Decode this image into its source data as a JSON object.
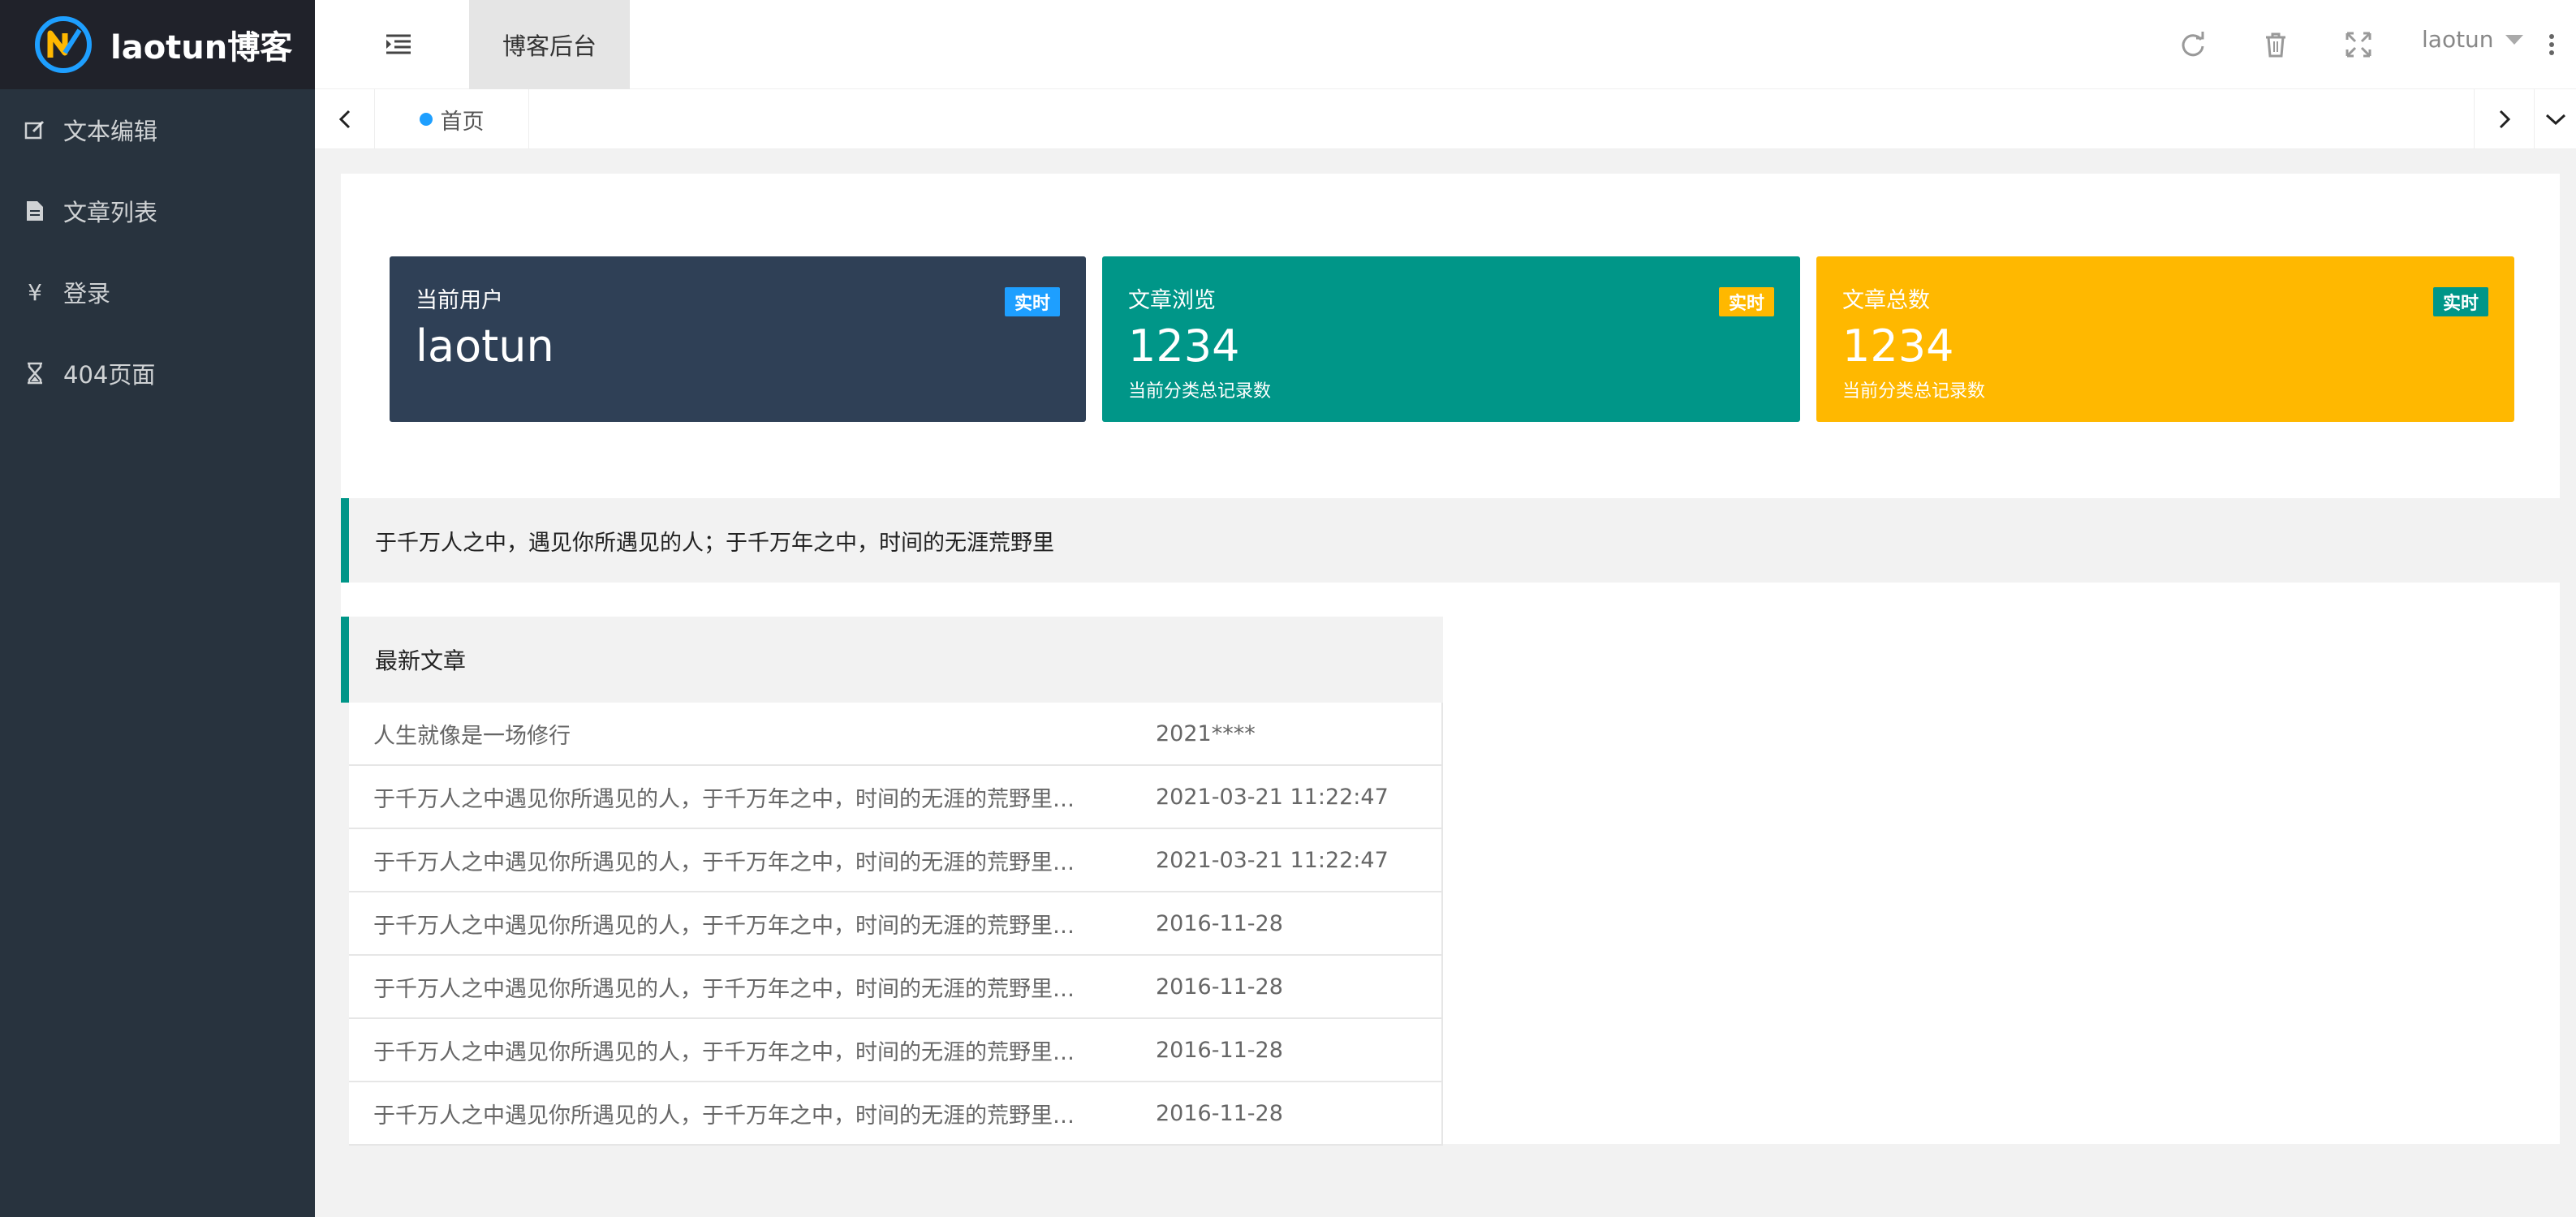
{
  "app": {
    "brand": "laotun博客",
    "header_tab": "博客后台",
    "user": "laotun"
  },
  "sidebar": {
    "items": [
      {
        "label": "文本编辑",
        "icon": "edit-icon"
      },
      {
        "label": "文章列表",
        "icon": "document-icon"
      },
      {
        "label": "登录",
        "icon": "yen-icon"
      },
      {
        "label": "404页面",
        "icon": "hourglass-icon"
      }
    ]
  },
  "tabs": {
    "home": "首页"
  },
  "cards": [
    {
      "title": "当前用户",
      "value": "laotun",
      "sub": "",
      "badge": "实时",
      "color": "#2f4056",
      "badge_color": "#1e9fff"
    },
    {
      "title": "文章浏览",
      "value": "1234",
      "sub": "当前分类总记录数",
      "badge": "实时",
      "color": "#009688",
      "badge_color": "#ffb800"
    },
    {
      "title": "文章总数",
      "value": "1234",
      "sub": "当前分类总记录数",
      "badge": "实时",
      "color": "#ffb800",
      "badge_color": "#009688"
    }
  ],
  "quote": "于千万人之中，遇见你所遇见的人；于千万年之中，时间的无涯荒野里",
  "latest": {
    "title": "最新文章",
    "rows": [
      {
        "title": "人生就像是一场修行",
        "date": "2021****"
      },
      {
        "title": "于千万人之中遇见你所遇见的人，于千万年之中，时间的无涯的荒野里…",
        "date": "2021-03-21 11:22:47"
      },
      {
        "title": "于千万人之中遇见你所遇见的人，于千万年之中，时间的无涯的荒野里…",
        "date": "2021-03-21 11:22:47"
      },
      {
        "title": "于千万人之中遇见你所遇见的人，于千万年之中，时间的无涯的荒野里…",
        "date": "2016-11-28"
      },
      {
        "title": "于千万人之中遇见你所遇见的人，于千万年之中，时间的无涯的荒野里…",
        "date": "2016-11-28"
      },
      {
        "title": "于千万人之中遇见你所遇见的人，于千万年之中，时间的无涯的荒野里…",
        "date": "2016-11-28"
      },
      {
        "title": "于千万人之中遇见你所遇见的人，于千万年之中，时间的无涯的荒野里…",
        "date": "2016-11-28"
      }
    ]
  },
  "colors": {
    "sidebar_bg": "#28333e",
    "accent": "#009688",
    "primary_blue": "#1e9fff",
    "warning": "#ffb800"
  }
}
